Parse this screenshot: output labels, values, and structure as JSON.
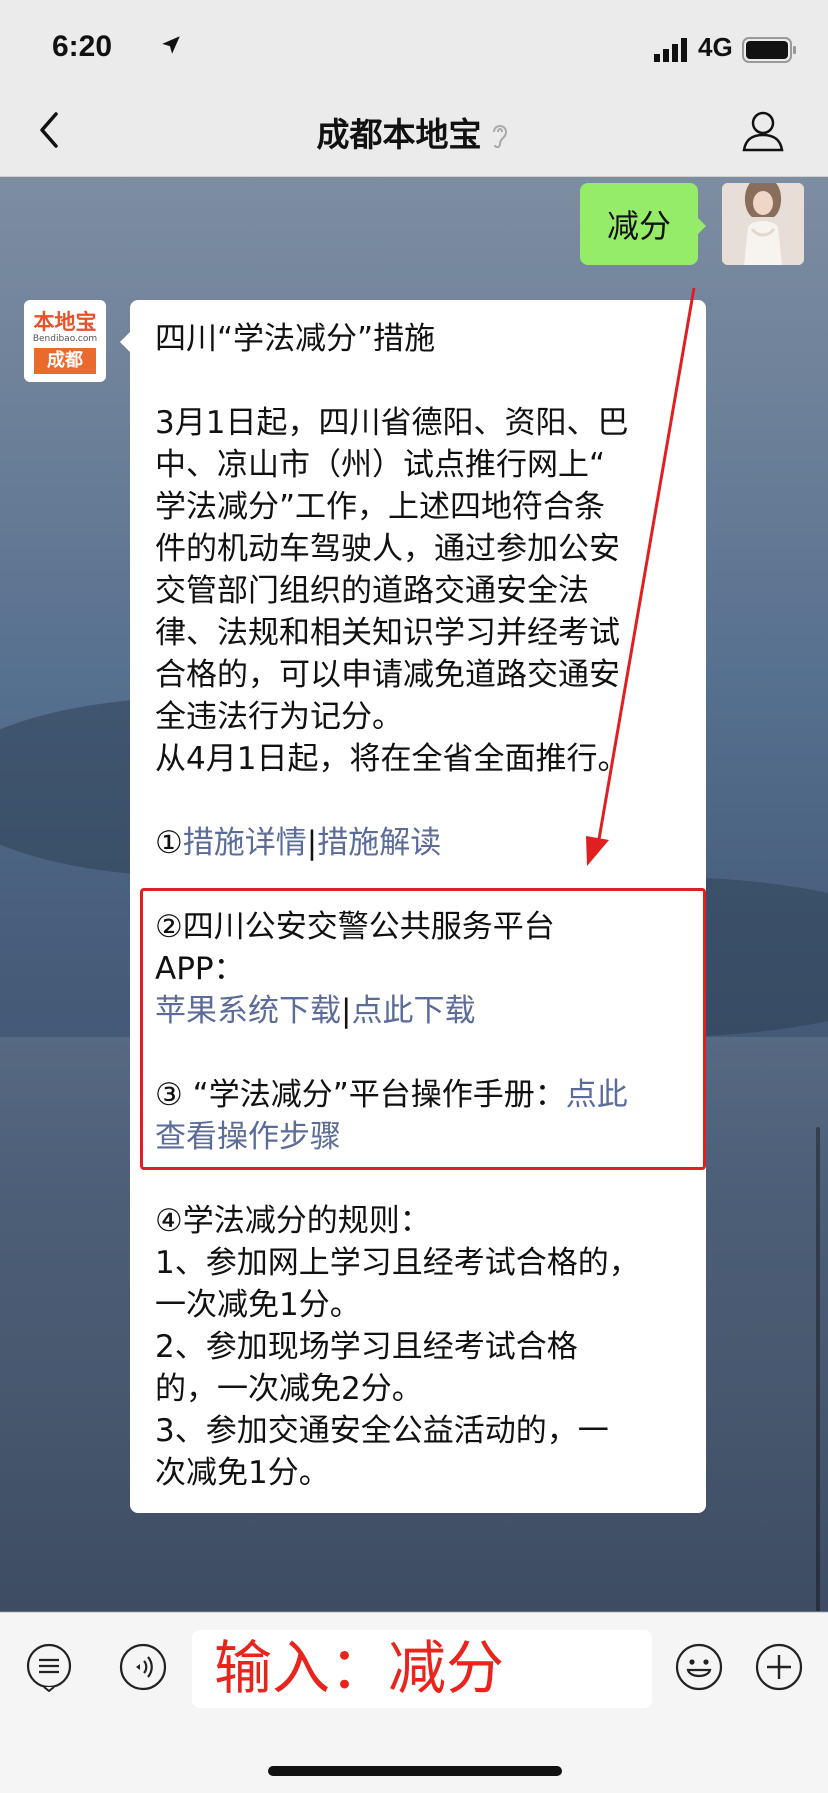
{
  "status": {
    "time": "6:20",
    "network": "4G"
  },
  "header": {
    "title": "成都本地宝"
  },
  "outgoing": {
    "text": "减分"
  },
  "bot": {
    "avatar_top": "本地宝",
    "avatar_mid": "Bendibao.com",
    "avatar_city": "成都"
  },
  "message": {
    "title": "四川“学法减分”措施",
    "body": [
      "3月1日起，四川省德阳、资阳、巴",
      "中、凉山市（州）试点推行网上“",
      "学法减分”工作，上述四地符合条",
      "件的机动车驾驶人，通过参加公安",
      "交管部门组织的道路交通安全法",
      "律、法规和相关知识学习并经考试",
      "合格的，可以申请减免道路交通安",
      "全违法行为记分。",
      "从4月1日起，将在全省全面推行。"
    ],
    "item1_prefix": "①",
    "item1_link1": "措施详情",
    "item1_sep": "|",
    "item1_link2": "措施解读",
    "item2_line1": "②四川公安交警公共服务平台",
    "item2_line2": "APP：",
    "item2_link1": "苹果系统下载",
    "item2_sep": "|",
    "item2_link2": "点此下载",
    "item3_text": "③ “学法减分”平台操作手册：",
    "item3_link_a": "点此",
    "item3_link_b": "查看操作步骤",
    "rules": [
      "④学法减分的规则：",
      "1、参加网上学习且经考试合格的，",
      "一次减免1分。",
      "2、参加现场学习且经考试合格",
      "的，一次减免2分。",
      "3、参加交通安全公益活动的，一",
      "次减免1分。"
    ]
  },
  "input": {
    "text": "输入：减分"
  },
  "icons": [
    "location-arrow-icon",
    "signal-icon",
    "battery-icon",
    "back-icon",
    "ear-icon",
    "profile-icon",
    "menu-list-icon",
    "voice-icon",
    "emoji-icon",
    "plus-icon"
  ]
}
